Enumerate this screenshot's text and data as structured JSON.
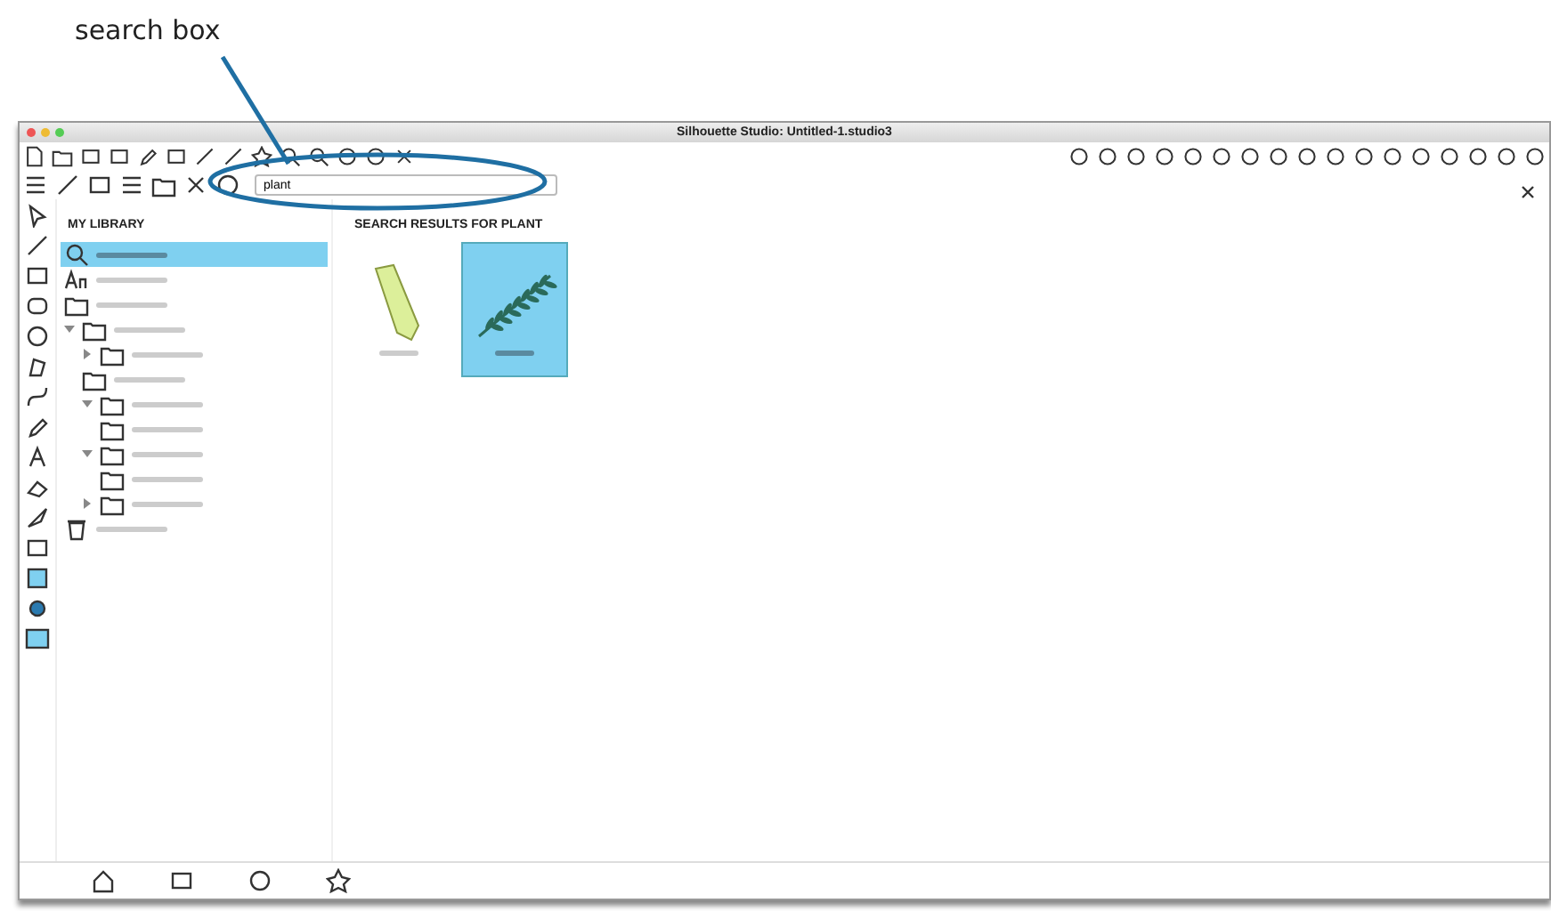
{
  "annotation": {
    "label": "search box"
  },
  "window": {
    "title": "Silhouette Studio: Untitled-1.studio3"
  },
  "search": {
    "value": "plant"
  },
  "library": {
    "heading": "MY LIBRARY",
    "items": [
      {
        "kind": "search",
        "selected": true
      },
      {
        "kind": "fonts",
        "selected": false
      },
      {
        "kind": "folder",
        "selected": false
      },
      {
        "kind": "folder",
        "selected": false,
        "expanded": true,
        "children": [
          {
            "kind": "folder",
            "selected": false,
            "expanded": false
          },
          {
            "kind": "folder",
            "selected": false
          },
          {
            "kind": "folder",
            "selected": false,
            "expanded": true,
            "children": [
              {
                "kind": "folder",
                "selected": false
              }
            ]
          },
          {
            "kind": "folder",
            "selected": false,
            "expanded": true,
            "children": [
              {
                "kind": "folder",
                "selected": false
              }
            ]
          },
          {
            "kind": "folder",
            "selected": false,
            "expanded": false
          }
        ]
      },
      {
        "kind": "trash",
        "selected": false
      }
    ]
  },
  "results": {
    "heading": "SEARCH RESULTS FOR PLANT",
    "items": [
      {
        "kind": "leaf-pattern",
        "selected": false
      },
      {
        "kind": "fern",
        "selected": true
      }
    ]
  }
}
